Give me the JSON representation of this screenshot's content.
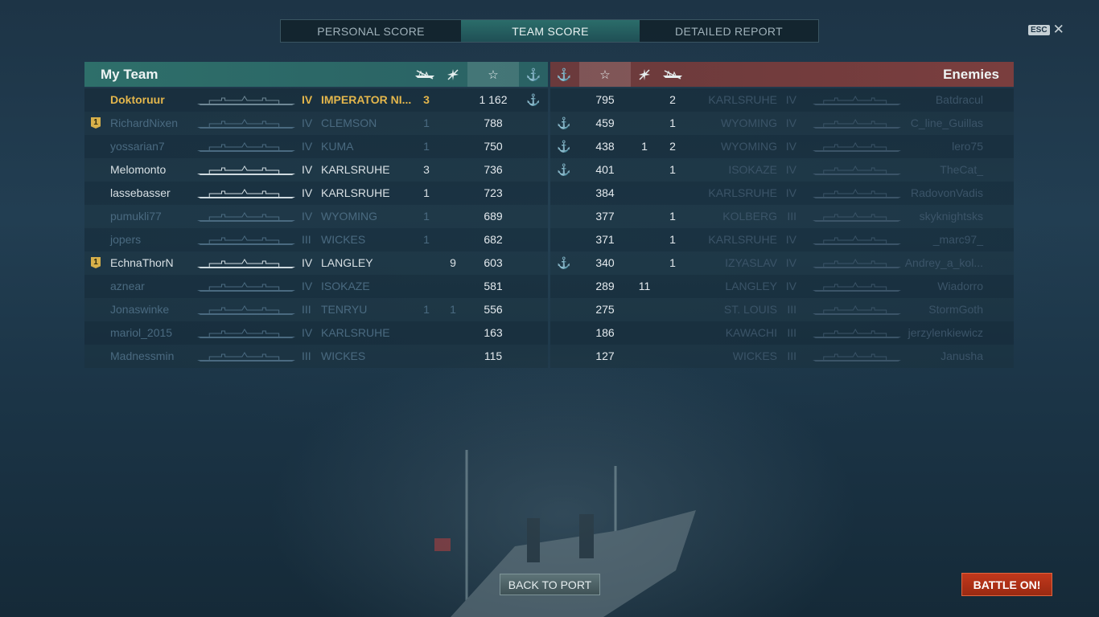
{
  "tabs": [
    {
      "label": "PERSONAL SCORE",
      "active": false
    },
    {
      "label": "TEAM SCORE",
      "active": true
    },
    {
      "label": "DETAILED REPORT",
      "active": false
    }
  ],
  "esc": {
    "key": "ESC",
    "close_glyph": "✕"
  },
  "my_team": {
    "title": "My Team",
    "columns": {
      "ships_icon": "ship-kill-icon",
      "planes_icon": "plane-kill-icon",
      "score_icon": "☆",
      "capture_icon": "⚓"
    },
    "rows": [
      {
        "rank": "",
        "player": "Doktoruur",
        "tier": "IV",
        "ship": "IMPERATOR NI...",
        "kills": "3",
        "planes": "",
        "score": "1 162",
        "capture": "⚓",
        "style": "self"
      },
      {
        "rank": "1",
        "player": "RichardNixen",
        "tier": "IV",
        "ship": "CLEMSON",
        "kills": "1",
        "planes": "",
        "score": "788",
        "capture": "",
        "style": "dim"
      },
      {
        "rank": "",
        "player": "yossarian7",
        "tier": "IV",
        "ship": "KUMA",
        "kills": "1",
        "planes": "",
        "score": "750",
        "capture": "",
        "style": "dim"
      },
      {
        "rank": "",
        "player": "Melomonto",
        "tier": "IV",
        "ship": "KARLSRUHE",
        "kills": "3",
        "planes": "",
        "score": "736",
        "capture": "",
        "style": "alive"
      },
      {
        "rank": "",
        "player": "lassebasser",
        "tier": "IV",
        "ship": "KARLSRUHE",
        "kills": "1",
        "planes": "",
        "score": "723",
        "capture": "",
        "style": "alive"
      },
      {
        "rank": "",
        "player": "pumukli77",
        "tier": "IV",
        "ship": "WYOMING",
        "kills": "1",
        "planes": "",
        "score": "689",
        "capture": "",
        "style": "dim"
      },
      {
        "rank": "",
        "player": "jopers",
        "tier": "III",
        "ship": "WICKES",
        "kills": "1",
        "planes": "",
        "score": "682",
        "capture": "",
        "style": "dim"
      },
      {
        "rank": "1",
        "player": "EchnaThorN",
        "tier": "IV",
        "ship": "LANGLEY",
        "kills": "",
        "planes": "9",
        "score": "603",
        "capture": "",
        "style": "alive"
      },
      {
        "rank": "",
        "player": "aznear",
        "tier": "IV",
        "ship": "ISOKAZE",
        "kills": "",
        "planes": "",
        "score": "581",
        "capture": "",
        "style": "dim"
      },
      {
        "rank": "",
        "player": "Jonaswinke",
        "tier": "III",
        "ship": "TENRYU",
        "kills": "1",
        "planes": "1",
        "score": "556",
        "capture": "",
        "style": "dim"
      },
      {
        "rank": "",
        "player": "mariol_2015",
        "tier": "IV",
        "ship": "KARLSRUHE",
        "kills": "",
        "planes": "",
        "score": "163",
        "capture": "",
        "style": "dim"
      },
      {
        "rank": "",
        "player": "Madnessmin",
        "tier": "III",
        "ship": "WICKES",
        "kills": "",
        "planes": "",
        "score": "115",
        "capture": "",
        "style": "dim"
      }
    ]
  },
  "enemies": {
    "title": "Enemies",
    "columns": {
      "capture_icon": "⚓",
      "score_icon": "☆",
      "planes_icon": "plane-kill-icon",
      "ships_icon": "ship-kill-icon"
    },
    "rows": [
      {
        "capture": "",
        "score": "795",
        "planes": "",
        "kills": "2",
        "ship": "KARLSRUHE",
        "tier": "IV",
        "player": "Batdracul"
      },
      {
        "capture": "⚓",
        "score": "459",
        "planes": "",
        "kills": "1",
        "ship": "WYOMING",
        "tier": "IV",
        "player": "C_line_Guillas"
      },
      {
        "capture": "⚓",
        "score": "438",
        "planes": "1",
        "kills": "2",
        "ship": "WYOMING",
        "tier": "IV",
        "player": "lero75"
      },
      {
        "capture": "⚓",
        "score": "401",
        "planes": "",
        "kills": "1",
        "ship": "ISOKAZE",
        "tier": "IV",
        "player": "TheCat_"
      },
      {
        "capture": "",
        "score": "384",
        "planes": "",
        "kills": "",
        "ship": "KARLSRUHE",
        "tier": "IV",
        "player": "RadovonVadis"
      },
      {
        "capture": "",
        "score": "377",
        "planes": "",
        "kills": "1",
        "ship": "KOLBERG",
        "tier": "III",
        "player": "skyknightsks"
      },
      {
        "capture": "",
        "score": "371",
        "planes": "",
        "kills": "1",
        "ship": "KARLSRUHE",
        "tier": "IV",
        "player": "_marc97_"
      },
      {
        "capture": "⚓",
        "score": "340",
        "planes": "",
        "kills": "1",
        "ship": "IZYASLAV",
        "tier": "IV",
        "player": "Andrey_a_kol..."
      },
      {
        "capture": "",
        "score": "289",
        "planes": "11",
        "kills": "",
        "ship": "LANGLEY",
        "tier": "IV",
        "player": "Wiadorro"
      },
      {
        "capture": "",
        "score": "275",
        "planes": "",
        "kills": "",
        "ship": "ST. LOUIS",
        "tier": "III",
        "player": "StormGoth"
      },
      {
        "capture": "",
        "score": "186",
        "planes": "",
        "kills": "",
        "ship": "KAWACHI",
        "tier": "III",
        "player": "jerzylenkiewicz"
      },
      {
        "capture": "",
        "score": "127",
        "planes": "",
        "kills": "",
        "ship": "WICKES",
        "tier": "III",
        "player": "Janusha"
      }
    ]
  },
  "buttons": {
    "back": "BACK TO PORT",
    "battle": "BATTLE ON!"
  },
  "colors": {
    "my_team_header": "#2e6f6a",
    "enemy_header": "#7a3e3e",
    "self_highlight": "#e3b64c",
    "battle_button": "#c2381c"
  }
}
